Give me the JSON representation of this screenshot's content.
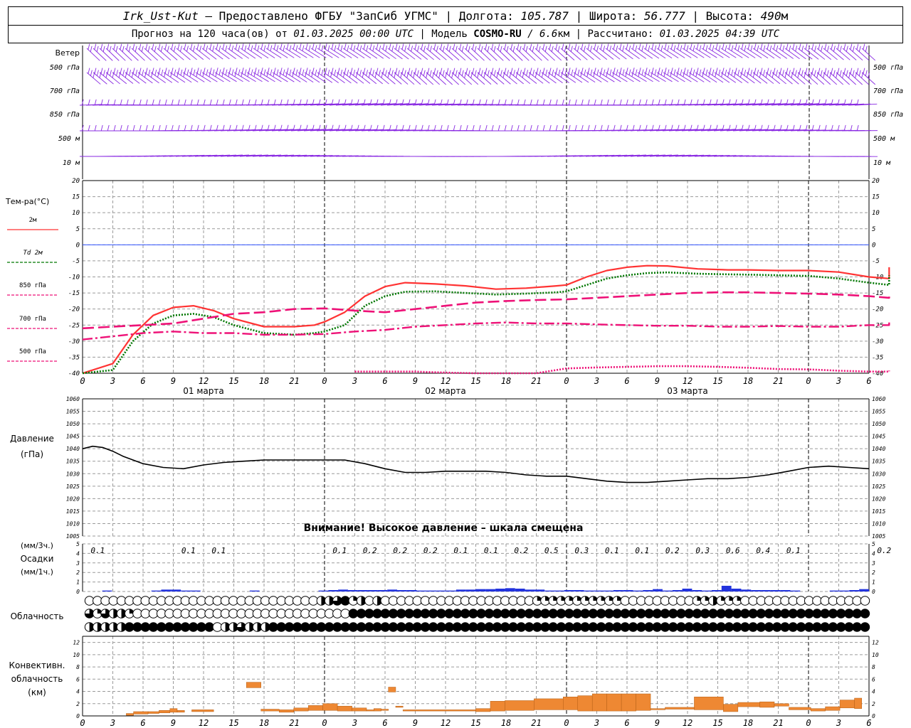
{
  "header": {
    "station": "Irk_Ust-Kut",
    "provider": " – Предоставлено ФГБУ \"ЗапСиб УГМС\" | Долгота: ",
    "longitude": "105.787",
    "lat_label": " | Широта: ",
    "latitude": "56.777",
    "alt_label": " | Высота: ",
    "altitude": "490",
    "alt_unit": "м",
    "forecast_label": "Прогноз на 120 часа(ов) от ",
    "forecast_start": "01.03.2025 00:00 UTC",
    "model_label": " | Модель ",
    "model_name": "COSMO-RU",
    "model_res": " / 6.6",
    "model_res_unit": "км",
    "computed_label": " | Рассчитано: ",
    "computed_time": "01.03.2025 04:39 UTC"
  },
  "colors": {
    "grid": "#9a9a9a",
    "wind": "#8a2be2",
    "t2m": "#ff3333",
    "td2m": "#007700",
    "t850": "#ee1177",
    "t700": "#ee1177",
    "t500": "#ee1177",
    "zero_line": "#3355ff",
    "pressure": "#000000",
    "precip": "#2233dd",
    "convective": "#ee8833"
  },
  "time_axis": {
    "hour_labels": [
      "0",
      "3",
      "6",
      "9",
      "12",
      "15",
      "18",
      "21",
      "0",
      "3",
      "6",
      "9",
      "12",
      "15",
      "18",
      "21",
      "0",
      "3",
      "6",
      "9",
      "12",
      "15",
      "18",
      "21",
      "0",
      "3",
      "6"
    ],
    "date_labels": [
      "01 марта",
      "02 марта",
      "03 марта"
    ]
  },
  "wind_panel": {
    "title": "Ветер",
    "levels": [
      "500 гПа",
      "700 гПа",
      "850 гПа",
      "500  м",
      "10  м"
    ]
  },
  "chart_data": [
    {
      "type": "line",
      "title": "Тем-ра(°C)",
      "ylim": [
        -40,
        20
      ],
      "yticks": [
        20,
        15,
        10,
        5,
        0,
        -5,
        -10,
        -15,
        -20,
        -25,
        -30,
        -35,
        -40
      ],
      "x_unit": "hours since 01.03.2025 00:00 UTC",
      "series": [
        {
          "name": "2м",
          "style": "solid",
          "x": [
            0,
            3,
            5,
            7,
            9,
            11,
            13,
            15,
            18,
            21,
            23,
            24,
            26,
            28,
            30,
            32,
            35,
            38,
            41,
            44,
            47,
            48,
            50,
            52,
            54,
            56,
            58,
            61,
            64,
            66,
            69,
            72,
            75,
            78
          ],
          "y": [
            -44,
            -37,
            -28,
            -22,
            -19.5,
            -19,
            -20.5,
            -23,
            -25.5,
            -25.5,
            -25,
            -24,
            -21,
            -16,
            -13,
            -11.8,
            -12.2,
            -12.8,
            -13.8,
            -13.5,
            -12.8,
            -12.5,
            -10,
            -8,
            -7,
            -6.5,
            -6.6,
            -7.5,
            -7.8,
            -7.8,
            -8,
            -8,
            -8.5,
            -10
          ],
          "y_tail": [
            -10.5,
            -9,
            -7
          ]
        },
        {
          "name": "Td 2м",
          "style": "dotted",
          "x": [
            0,
            3,
            5,
            7,
            9,
            11,
            13,
            15,
            18,
            21,
            23,
            24,
            26,
            28,
            30,
            32,
            35,
            38,
            41,
            44,
            47,
            48,
            50,
            52,
            54,
            56,
            58,
            61,
            64,
            66,
            69,
            72,
            75,
            78
          ],
          "y": [
            -45,
            -39,
            -30,
            -24.5,
            -22,
            -21.5,
            -22.5,
            -25,
            -27.5,
            -28,
            -27.5,
            -27,
            -25,
            -19,
            -16,
            -14.6,
            -14.5,
            -15,
            -15.5,
            -15.2,
            -14.8,
            -14.5,
            -12.5,
            -10.5,
            -9.5,
            -8.8,
            -8.6,
            -9,
            -9.2,
            -9.3,
            -9.5,
            -9.7,
            -10.5,
            -11.8
          ],
          "y_tail": [
            -12.5,
            -11,
            -9.5
          ]
        },
        {
          "name": "850 гПа",
          "style": "longdash",
          "x": [
            0,
            3,
            6,
            9,
            12,
            15,
            18,
            21,
            24,
            27,
            30,
            33,
            36,
            39,
            42,
            45,
            48,
            51,
            54,
            57,
            60,
            63,
            66,
            69,
            72,
            75,
            78
          ],
          "y": [
            -26,
            -25.5,
            -25,
            -24.5,
            -23,
            -21.5,
            -21,
            -20,
            -19.8,
            -20.5,
            -21,
            -20,
            -19,
            -18,
            -17.5,
            -17.2,
            -17,
            -16.5,
            -16,
            -15.5,
            -15,
            -14.8,
            -14.8,
            -15,
            -15.2,
            -15.5,
            -16
          ],
          "y_tail": [
            -16.5,
            -16.2,
            -15.8
          ]
        },
        {
          "name": "700 гПа",
          "style": "dashdot",
          "x": [
            0,
            3,
            6,
            9,
            12,
            15,
            18,
            21,
            24,
            27,
            30,
            33,
            36,
            39,
            42,
            45,
            48,
            51,
            54,
            57,
            60,
            63,
            66,
            69,
            72,
            75,
            78
          ],
          "y": [
            -29.5,
            -28.5,
            -27.5,
            -27,
            -27.5,
            -27.5,
            -28,
            -28,
            -27.8,
            -27,
            -26.5,
            -25.5,
            -25,
            -24.5,
            -24.2,
            -24.5,
            -24.5,
            -24.8,
            -25,
            -25.2,
            -25.2,
            -25.5,
            -25.5,
            -25.3,
            -25.5,
            -25.5,
            -25
          ],
          "y_tail": [
            -25,
            -24.5,
            -24.2
          ]
        },
        {
          "name": "500 гПа",
          "style": "dotted",
          "x": [
            27,
            30,
            33,
            36,
            39,
            42,
            45,
            48,
            51,
            54,
            57,
            60,
            63,
            66,
            69,
            72,
            75,
            78
          ],
          "y": [
            -39.5,
            -39.5,
            -39.5,
            -39.8,
            -40.5,
            -41,
            -41,
            -38.5,
            -38.2,
            -38,
            -37.8,
            -37.8,
            -38,
            -38.3,
            -38.7,
            -38.8,
            -39.2,
            -39.5
          ],
          "y_tail": [
            -39.5,
            -39.5,
            -39.2
          ]
        }
      ]
    },
    {
      "type": "line",
      "title": "Давление",
      "ylabel": "(гПа)",
      "ylim": [
        1005,
        1060
      ],
      "yticks": [
        1060,
        1055,
        1050,
        1045,
        1040,
        1035,
        1030,
        1025,
        1020,
        1015,
        1010,
        1005
      ],
      "note": "Внимание! Высокое давление – шкала смещена",
      "series": [
        {
          "name": "pressure",
          "x": [
            0,
            1,
            2,
            3,
            4,
            6,
            8,
            10,
            12,
            14,
            16,
            18,
            20,
            22,
            24,
            26,
            28,
            30,
            32,
            34,
            36,
            38,
            40,
            42,
            44,
            46,
            48,
            50,
            52,
            54,
            56,
            58,
            60,
            62,
            64,
            66,
            68,
            70,
            72,
            74,
            76,
            78
          ],
          "y": [
            1040,
            1041,
            1040.5,
            1039,
            1037,
            1034,
            1032.5,
            1032,
            1033.5,
            1034.5,
            1035,
            1035.5,
            1035.5,
            1035.5,
            1035.5,
            1035.5,
            1034,
            1032,
            1030.5,
            1030.5,
            1031,
            1031,
            1031,
            1030.5,
            1029.5,
            1029,
            1029,
            1028,
            1027,
            1026.5,
            1026.5,
            1027,
            1027.5,
            1028,
            1028,
            1028.5,
            1029.5,
            1031,
            1032.5,
            1033,
            1032.5,
            1032
          ]
        }
      ]
    },
    {
      "type": "bar",
      "title": "Осадки",
      "ylabel_3h": "(мм/3ч.)",
      "ylabel_1h": "(мм/1ч.)",
      "ylim": [
        0,
        5
      ],
      "yticks": [
        5,
        4,
        3,
        2,
        1,
        0
      ],
      "amounts_3h": [
        0.1,
        null,
        null,
        0.1,
        0.1,
        null,
        null,
        null,
        0.1,
        0.2,
        0.2,
        0.2,
        0.1,
        0.1,
        0.2,
        0.5,
        0.3,
        0.1,
        0.1,
        0.2,
        0.3,
        0.6,
        0.4,
        0.1,
        null,
        null,
        0.2
      ],
      "hourly": [
        0,
        0,
        0.1,
        0,
        0,
        0,
        0,
        0.1,
        0.2,
        0.2,
        0.1,
        0.1,
        0,
        0,
        0,
        0,
        0,
        0.1,
        0,
        0,
        0,
        0,
        0,
        0,
        0.1,
        0.15,
        0.2,
        0.15,
        0.15,
        0.15,
        0.15,
        0.2,
        0.15,
        0.15,
        0.1,
        0.1,
        0.1,
        0.1,
        0.2,
        0.2,
        0.25,
        0.25,
        0.3,
        0.35,
        0.3,
        0.2,
        0.2,
        0.1,
        0.1,
        0.15,
        0.15,
        0.1,
        0.1,
        0.1,
        0.15,
        0.15,
        0.1,
        0.15,
        0.25,
        0.1,
        0.15,
        0.3,
        0.15,
        0.1,
        0.15,
        0.6,
        0.3,
        0.2,
        0.15,
        0.15,
        0.15,
        0.15,
        0.1,
        0,
        0,
        0,
        0.1,
        0.1,
        0.15,
        0.25
      ]
    },
    {
      "type": "table",
      "title": "Облачность",
      "rows": [
        "00000000000000000000000000000223412020000000000000000000111111111110000000001121110000000000000000",
        "31322100000000000000000000000000044444444444444444444444444444444444444444444444444444444444444444",
        "22222444444444440223222444444444444444444444444444444444444444444444444444444444444444444444444444"
      ]
    },
    {
      "type": "bar",
      "title": "Конвективн. облачность",
      "ylabel": "(км)",
      "ylim": [
        0,
        13
      ],
      "yticks": [
        12,
        10,
        8,
        6,
        4,
        2,
        0
      ],
      "segments": [
        {
          "from": 6,
          "to": 7,
          "base": 0.1,
          "top": 0.4
        },
        {
          "from": 7,
          "to": 9,
          "base": 0.3,
          "top": 0.7
        },
        {
          "from": 9,
          "to": 10.5,
          "base": 0.4,
          "top": 0.7
        },
        {
          "from": 10.5,
          "to": 12,
          "base": 0.5,
          "top": 0.9
        },
        {
          "from": 12,
          "to": 13,
          "base": 0.6,
          "top": 1.2
        },
        {
          "from": 13,
          "to": 14,
          "base": 0.6,
          "top": 0.9
        },
        {
          "from": 15,
          "to": 18,
          "base": 0.7,
          "top": 1.0
        },
        {
          "from": 22.5,
          "to": 24.5,
          "base": 4.6,
          "top": 5.5
        },
        {
          "from": 24.5,
          "to": 27,
          "base": 0.8,
          "top": 1.1
        },
        {
          "from": 27,
          "to": 29,
          "base": 0.6,
          "top": 1.0
        },
        {
          "from": 29,
          "to": 31,
          "base": 0.8,
          "top": 1.3
        },
        {
          "from": 31,
          "to": 33,
          "base": 0.9,
          "top": 1.7
        },
        {
          "from": 33,
          "to": 35,
          "base": 0.9,
          "top": 2.0
        },
        {
          "from": 35,
          "to": 37,
          "base": 0.8,
          "top": 1.6
        },
        {
          "from": 37,
          "to": 39,
          "base": 0.8,
          "top": 1.3
        },
        {
          "from": 39,
          "to": 40,
          "base": 0.8,
          "top": 1.0
        },
        {
          "from": 40,
          "to": 41,
          "base": 0.8,
          "top": 1.2
        },
        {
          "from": 41,
          "to": 42,
          "base": 0.9,
          "top": 1.1
        },
        {
          "from": 42,
          "to": 43,
          "base": 3.9,
          "top": 4.7
        },
        {
          "from": 43,
          "to": 44,
          "base": 1.4,
          "top": 1.6
        },
        {
          "from": 44,
          "to": 54,
          "base": 0.8,
          "top": 1.0
        },
        {
          "from": 54,
          "to": 56,
          "base": 0.7,
          "top": 1.2
        },
        {
          "from": 56,
          "to": 58,
          "base": 0.8,
          "top": 2.4
        },
        {
          "from": 58,
          "to": 62,
          "base": 0.9,
          "top": 2.5
        },
        {
          "from": 62,
          "to": 66,
          "base": 1.0,
          "top": 2.8
        },
        {
          "from": 66,
          "to": 68,
          "base": 1.0,
          "top": 3.1
        },
        {
          "from": 68,
          "to": 70,
          "base": 0.8,
          "top": 3.3
        },
        {
          "from": 70,
          "to": 72,
          "base": 0.8,
          "top": 3.6
        },
        {
          "from": 72,
          "to": 74,
          "base": 0.8,
          "top": 3.6
        },
        {
          "from": 74,
          "to": 76,
          "base": 0.8,
          "top": 3.6
        },
        {
          "from": 76,
          "to": 78,
          "base": 0.9,
          "top": 3.6
        },
        {
          "from": 78,
          "to": 80,
          "base": 1.0,
          "top": 1.2
        },
        {
          "from": 80,
          "to": 84,
          "base": 1.1,
          "top": 1.4
        },
        {
          "from": 84,
          "to": 88,
          "base": 1.0,
          "top": 3.1
        },
        {
          "from": 88,
          "to": 90,
          "base": 0.7,
          "top": 1.9
        },
        {
          "from": 90,
          "to": 93,
          "base": 1.5,
          "top": 2.2
        },
        {
          "from": 93,
          "to": 95,
          "base": 1.4,
          "top": 2.3
        },
        {
          "from": 95,
          "to": 97,
          "base": 1.6,
          "top": 2.0
        },
        {
          "from": 97,
          "to": 100,
          "base": 1.0,
          "top": 1.4
        },
        {
          "from": 100,
          "to": 102,
          "base": 0.8,
          "top": 1.2
        },
        {
          "from": 102,
          "to": 104,
          "base": 0.9,
          "top": 1.5
        },
        {
          "from": 104,
          "to": 106,
          "base": 1.3,
          "top": 2.6
        },
        {
          "from": 106,
          "to": 107,
          "base": 1.2,
          "top": 2.9
        }
      ]
    }
  ]
}
